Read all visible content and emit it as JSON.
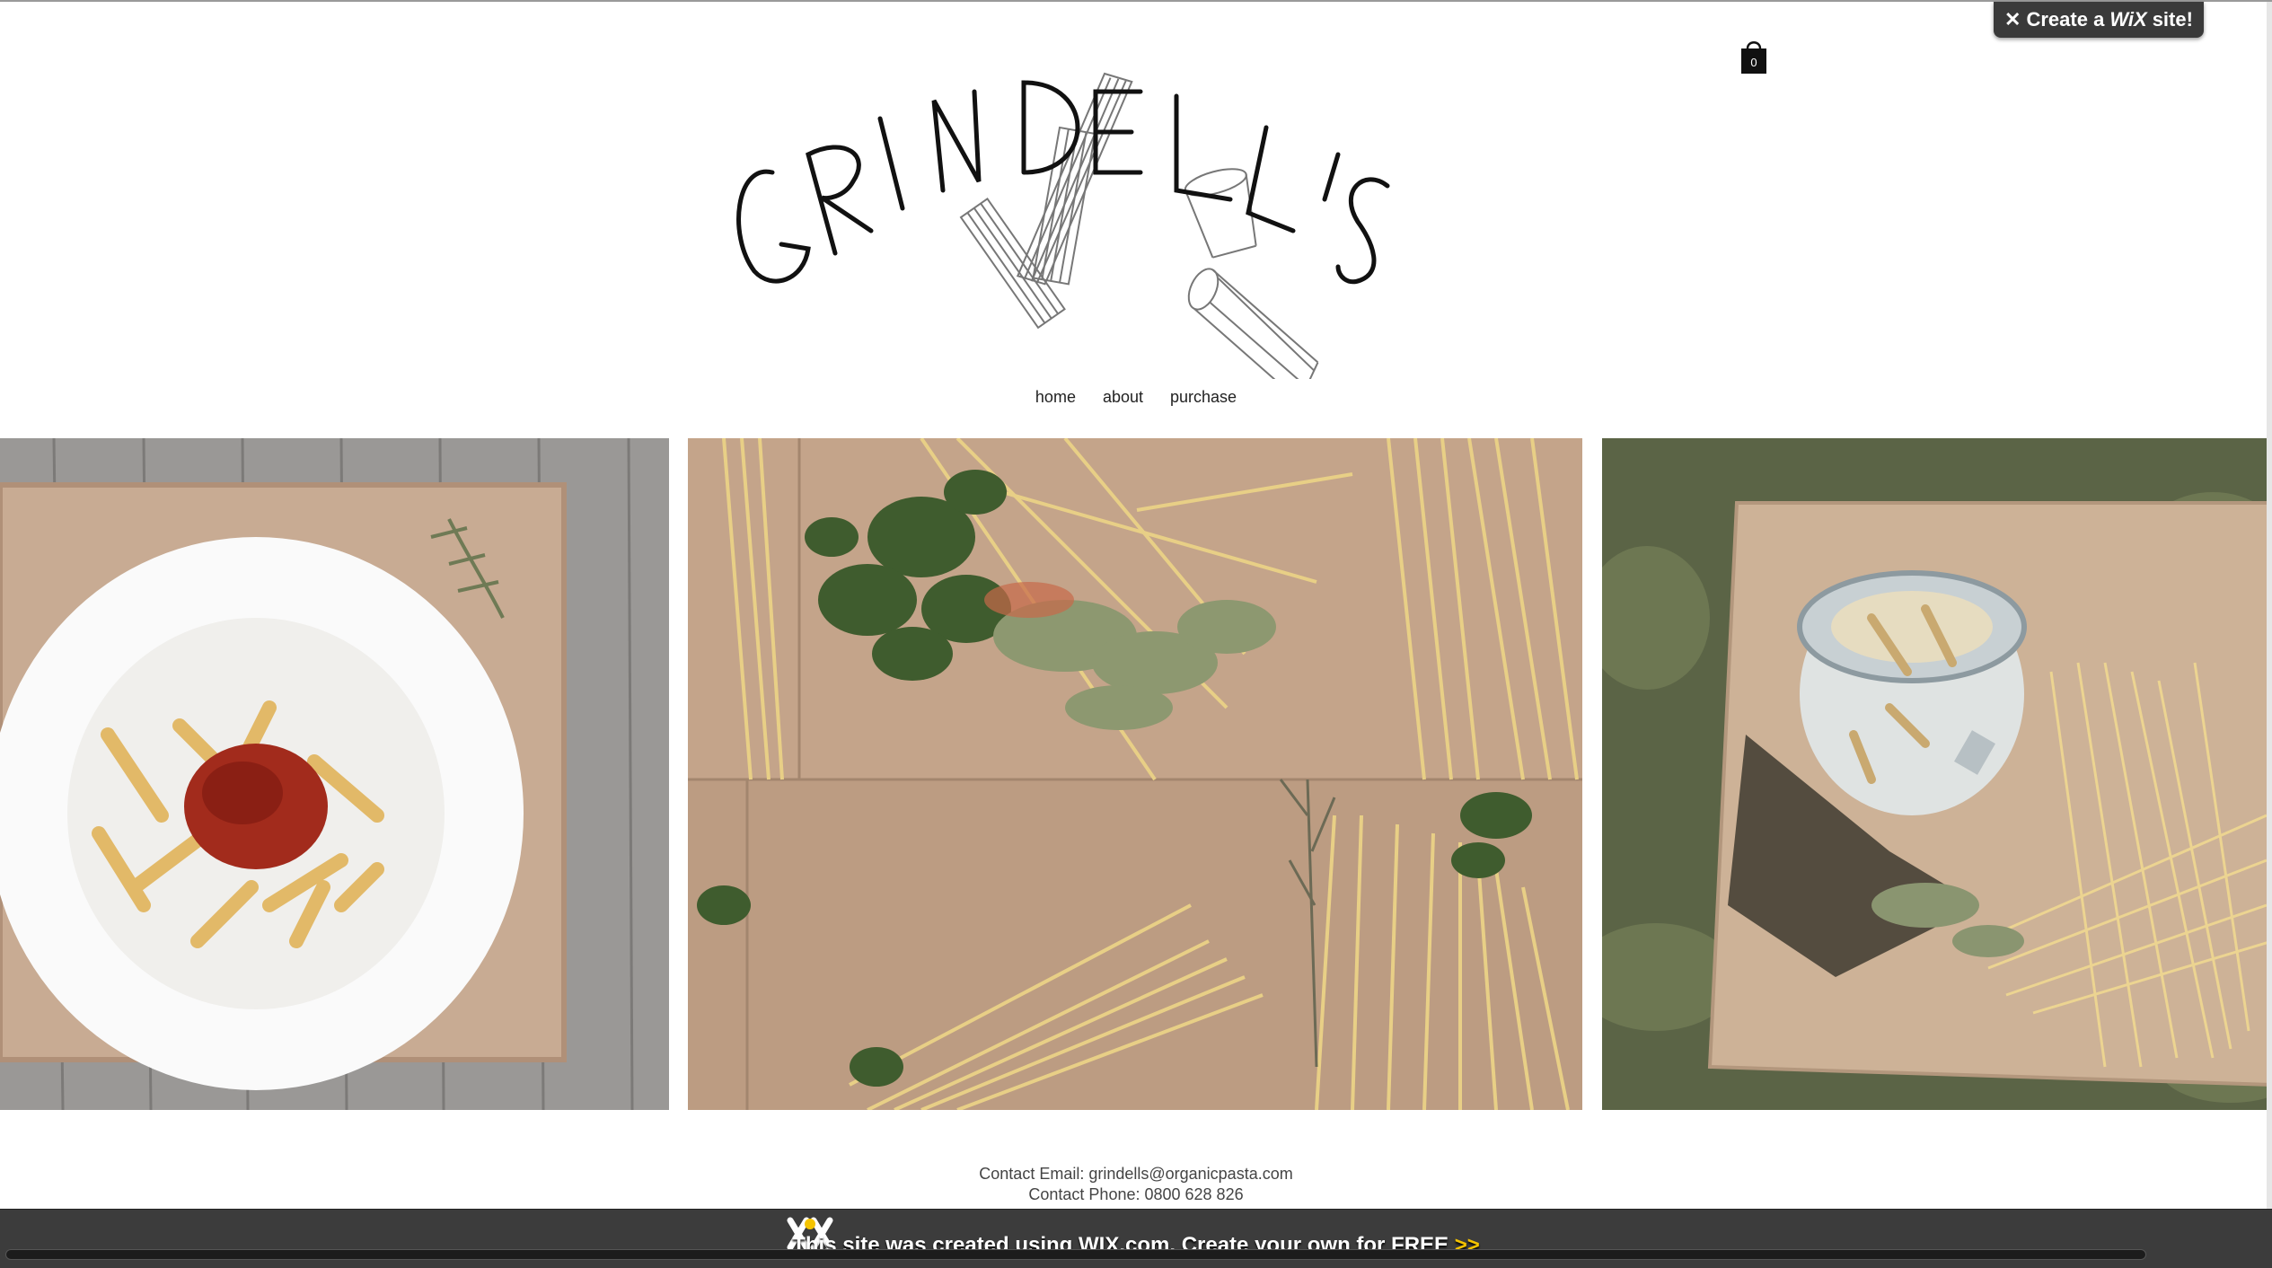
{
  "wix_badge": {
    "prefix": "Create a",
    "brand": "WiX",
    "suffix": "site!"
  },
  "cart": {
    "count": "0"
  },
  "logo": {
    "text": "GRINDELL'S"
  },
  "nav": [
    {
      "label": "home"
    },
    {
      "label": "about"
    },
    {
      "label": "purchase"
    }
  ],
  "gallery": [
    {
      "subject": "plate of penne with tomato sauce on wooden board"
    },
    {
      "subject": "spaghetti with fresh herbs and spices on wooden board"
    },
    {
      "subject": "glass jar of penne with spaghetti on board on grass"
    }
  ],
  "contact": {
    "email_line": "Contact Email: grindells@organicpasta.com",
    "phone_line": "Contact Phone: 0800 628 826"
  },
  "wix_bar": {
    "text": "This site was created using WIX.com. Create your own for FREE",
    "arrows": ">>"
  },
  "colors": {
    "bar": "#3c3c3c",
    "accent": "#f5c400",
    "background": "#ffffff"
  }
}
